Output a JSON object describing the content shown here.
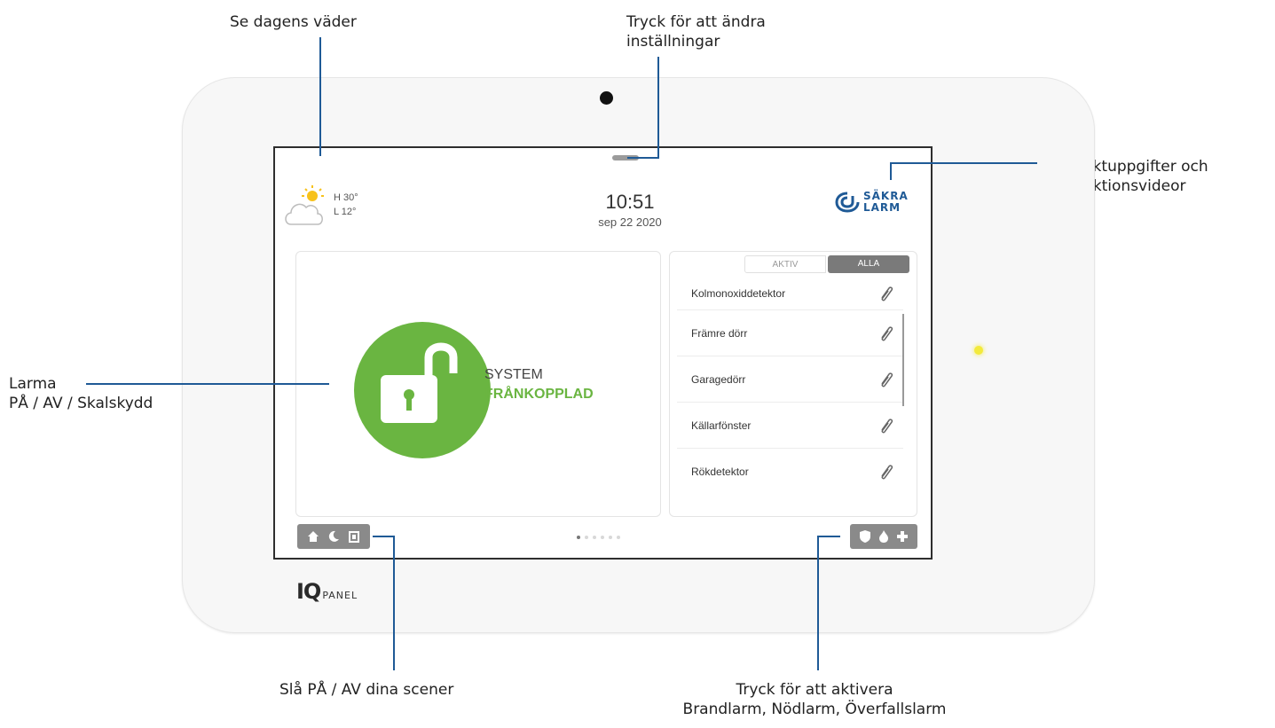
{
  "callouts": {
    "weather": "Se dagens väder",
    "settings_1": "Tryck för att ändra",
    "settings_2": "inställningar",
    "contact_1": "Kontaktuppgifter och",
    "contact_2": "instruktionsvideor",
    "arm_1": "Larma",
    "arm_2": "PÅ / AV / Skalskydd",
    "scenes": "Slå PÅ / AV dina scener",
    "emergency_1": "Tryck för att aktivera",
    "emergency_2": "Brandlarm, Nödlarm, Överfallslarm"
  },
  "weather": {
    "high": "H 30°",
    "low": "L 12°",
    "icon": "partly-cloudy-icon"
  },
  "clock": {
    "time": "10:51",
    "date": "sep 22 2020"
  },
  "logo": {
    "line1": "SÄKRA",
    "line2": "LARM",
    "color": "#1f5a96"
  },
  "system": {
    "line1": "SYSTEM",
    "line2": "FRÅNKOPPLAD",
    "color": "#6ab541"
  },
  "tabs": {
    "active": "AKTIV",
    "all": "ALLA"
  },
  "sensors": [
    {
      "name": "Kolmonoxiddetektor"
    },
    {
      "name": "Främre dörr"
    },
    {
      "name": "Garagedörr"
    },
    {
      "name": "Källarfönster"
    },
    {
      "name": "Rökdetektor"
    }
  ],
  "page_dots": {
    "count": 6,
    "current": 1
  },
  "device": {
    "brand_iq": "IQ",
    "brand_panel": "PANEL"
  }
}
